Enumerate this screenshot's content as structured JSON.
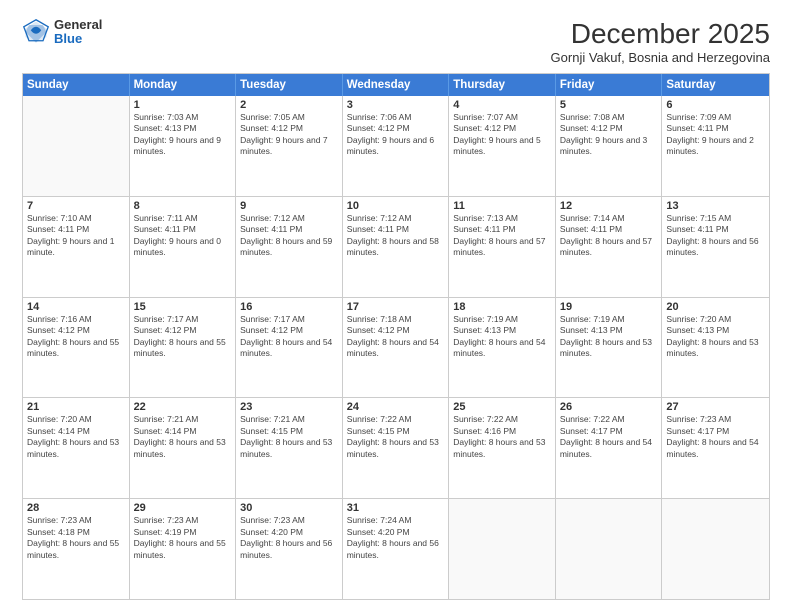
{
  "header": {
    "logo_general": "General",
    "logo_blue": "Blue",
    "title": "December 2025",
    "subtitle": "Gornji Vakuf, Bosnia and Herzegovina"
  },
  "day_names": [
    "Sunday",
    "Monday",
    "Tuesday",
    "Wednesday",
    "Thursday",
    "Friday",
    "Saturday"
  ],
  "rows": [
    [
      {
        "date": "",
        "sunrise": "",
        "sunset": "",
        "daylight": ""
      },
      {
        "date": "1",
        "sunrise": "Sunrise: 7:03 AM",
        "sunset": "Sunset: 4:13 PM",
        "daylight": "Daylight: 9 hours and 9 minutes."
      },
      {
        "date": "2",
        "sunrise": "Sunrise: 7:05 AM",
        "sunset": "Sunset: 4:12 PM",
        "daylight": "Daylight: 9 hours and 7 minutes."
      },
      {
        "date": "3",
        "sunrise": "Sunrise: 7:06 AM",
        "sunset": "Sunset: 4:12 PM",
        "daylight": "Daylight: 9 hours and 6 minutes."
      },
      {
        "date": "4",
        "sunrise": "Sunrise: 7:07 AM",
        "sunset": "Sunset: 4:12 PM",
        "daylight": "Daylight: 9 hours and 5 minutes."
      },
      {
        "date": "5",
        "sunrise": "Sunrise: 7:08 AM",
        "sunset": "Sunset: 4:12 PM",
        "daylight": "Daylight: 9 hours and 3 minutes."
      },
      {
        "date": "6",
        "sunrise": "Sunrise: 7:09 AM",
        "sunset": "Sunset: 4:11 PM",
        "daylight": "Daylight: 9 hours and 2 minutes."
      }
    ],
    [
      {
        "date": "7",
        "sunrise": "Sunrise: 7:10 AM",
        "sunset": "Sunset: 4:11 PM",
        "daylight": "Daylight: 9 hours and 1 minute."
      },
      {
        "date": "8",
        "sunrise": "Sunrise: 7:11 AM",
        "sunset": "Sunset: 4:11 PM",
        "daylight": "Daylight: 9 hours and 0 minutes."
      },
      {
        "date": "9",
        "sunrise": "Sunrise: 7:12 AM",
        "sunset": "Sunset: 4:11 PM",
        "daylight": "Daylight: 8 hours and 59 minutes."
      },
      {
        "date": "10",
        "sunrise": "Sunrise: 7:12 AM",
        "sunset": "Sunset: 4:11 PM",
        "daylight": "Daylight: 8 hours and 58 minutes."
      },
      {
        "date": "11",
        "sunrise": "Sunrise: 7:13 AM",
        "sunset": "Sunset: 4:11 PM",
        "daylight": "Daylight: 8 hours and 57 minutes."
      },
      {
        "date": "12",
        "sunrise": "Sunrise: 7:14 AM",
        "sunset": "Sunset: 4:11 PM",
        "daylight": "Daylight: 8 hours and 57 minutes."
      },
      {
        "date": "13",
        "sunrise": "Sunrise: 7:15 AM",
        "sunset": "Sunset: 4:11 PM",
        "daylight": "Daylight: 8 hours and 56 minutes."
      }
    ],
    [
      {
        "date": "14",
        "sunrise": "Sunrise: 7:16 AM",
        "sunset": "Sunset: 4:12 PM",
        "daylight": "Daylight: 8 hours and 55 minutes."
      },
      {
        "date": "15",
        "sunrise": "Sunrise: 7:17 AM",
        "sunset": "Sunset: 4:12 PM",
        "daylight": "Daylight: 8 hours and 55 minutes."
      },
      {
        "date": "16",
        "sunrise": "Sunrise: 7:17 AM",
        "sunset": "Sunset: 4:12 PM",
        "daylight": "Daylight: 8 hours and 54 minutes."
      },
      {
        "date": "17",
        "sunrise": "Sunrise: 7:18 AM",
        "sunset": "Sunset: 4:12 PM",
        "daylight": "Daylight: 8 hours and 54 minutes."
      },
      {
        "date": "18",
        "sunrise": "Sunrise: 7:19 AM",
        "sunset": "Sunset: 4:13 PM",
        "daylight": "Daylight: 8 hours and 54 minutes."
      },
      {
        "date": "19",
        "sunrise": "Sunrise: 7:19 AM",
        "sunset": "Sunset: 4:13 PM",
        "daylight": "Daylight: 8 hours and 53 minutes."
      },
      {
        "date": "20",
        "sunrise": "Sunrise: 7:20 AM",
        "sunset": "Sunset: 4:13 PM",
        "daylight": "Daylight: 8 hours and 53 minutes."
      }
    ],
    [
      {
        "date": "21",
        "sunrise": "Sunrise: 7:20 AM",
        "sunset": "Sunset: 4:14 PM",
        "daylight": "Daylight: 8 hours and 53 minutes."
      },
      {
        "date": "22",
        "sunrise": "Sunrise: 7:21 AM",
        "sunset": "Sunset: 4:14 PM",
        "daylight": "Daylight: 8 hours and 53 minutes."
      },
      {
        "date": "23",
        "sunrise": "Sunrise: 7:21 AM",
        "sunset": "Sunset: 4:15 PM",
        "daylight": "Daylight: 8 hours and 53 minutes."
      },
      {
        "date": "24",
        "sunrise": "Sunrise: 7:22 AM",
        "sunset": "Sunset: 4:15 PM",
        "daylight": "Daylight: 8 hours and 53 minutes."
      },
      {
        "date": "25",
        "sunrise": "Sunrise: 7:22 AM",
        "sunset": "Sunset: 4:16 PM",
        "daylight": "Daylight: 8 hours and 53 minutes."
      },
      {
        "date": "26",
        "sunrise": "Sunrise: 7:22 AM",
        "sunset": "Sunset: 4:17 PM",
        "daylight": "Daylight: 8 hours and 54 minutes."
      },
      {
        "date": "27",
        "sunrise": "Sunrise: 7:23 AM",
        "sunset": "Sunset: 4:17 PM",
        "daylight": "Daylight: 8 hours and 54 minutes."
      }
    ],
    [
      {
        "date": "28",
        "sunrise": "Sunrise: 7:23 AM",
        "sunset": "Sunset: 4:18 PM",
        "daylight": "Daylight: 8 hours and 55 minutes."
      },
      {
        "date": "29",
        "sunrise": "Sunrise: 7:23 AM",
        "sunset": "Sunset: 4:19 PM",
        "daylight": "Daylight: 8 hours and 55 minutes."
      },
      {
        "date": "30",
        "sunrise": "Sunrise: 7:23 AM",
        "sunset": "Sunset: 4:20 PM",
        "daylight": "Daylight: 8 hours and 56 minutes."
      },
      {
        "date": "31",
        "sunrise": "Sunrise: 7:24 AM",
        "sunset": "Sunset: 4:20 PM",
        "daylight": "Daylight: 8 hours and 56 minutes."
      },
      {
        "date": "",
        "sunrise": "",
        "sunset": "",
        "daylight": ""
      },
      {
        "date": "",
        "sunrise": "",
        "sunset": "",
        "daylight": ""
      },
      {
        "date": "",
        "sunrise": "",
        "sunset": "",
        "daylight": ""
      }
    ]
  ]
}
